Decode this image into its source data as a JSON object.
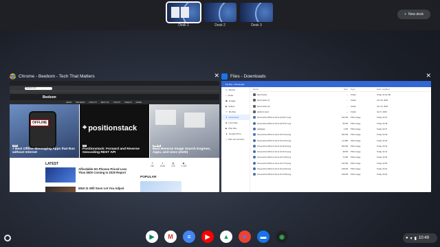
{
  "desks": [
    {
      "label": "Desk 1",
      "active": true
    },
    {
      "label": "Desk 2",
      "active": false
    },
    {
      "label": "Desk 3",
      "active": false
    }
  ],
  "new_desk_label": "New desk",
  "windows": {
    "chrome": {
      "title": "Chrome - Beebom - Tech That Matters",
      "url": "beebom.com",
      "site": {
        "brand": "Beebom",
        "nav": [
          "NEWS",
          "REVIEWS",
          "HOW TO",
          "BEST OF",
          "TOPICS",
          "VIDEOS",
          "MORE"
        ],
        "heroes": [
          {
            "caption": "7 Best Offline Messaging Apps that Run without Internet",
            "badge": "OFFLINE"
          },
          {
            "caption": "Positionstack: Forward and Reverse Geocoding REST API",
            "logo": "positionstack"
          },
          {
            "caption": "Best Reverse Image Search Engines, Apps, and Uses (2020)"
          }
        ],
        "latest_heading": "LATEST",
        "latest": [
          "Affordable 5G Phones Priced Less Than $500 Coming In 2020 Report",
          "MIUI 11 Will Soon Let You Adjust"
        ],
        "social": [
          {
            "icon": "f",
            "count": "1M"
          },
          {
            "icon": "t",
            "count": "413k"
          },
          {
            "icon": "◎",
            "count": "17k"
          },
          {
            "icon": "▶",
            "count": "1.1M"
          }
        ],
        "popular_heading": "POPULAR"
      }
    },
    "files": {
      "title": "Files - Downloads",
      "path": "My files  ›  Downloads",
      "sidebar": [
        "Recent",
        "Audio",
        "Images",
        "Videos",
        "My files",
        "Downloads",
        "Linux files",
        "Play files",
        "Google Drive",
        "Add new services"
      ],
      "columns": [
        "Name",
        "Size",
        "Type",
        "Date modified"
      ],
      "rows": [
        {
          "name": "New Folder",
          "size": "--",
          "type": "Folder",
          "date": "Today 10:41 AM"
        },
        {
          "name": "New Folder (1)",
          "size": "--",
          "type": "Folder",
          "date": "Jan 20, 2020"
        },
        {
          "name": "New Folder (2)",
          "size": "--",
          "type": "Folder",
          "date": "Jan 14, 2020"
        },
        {
          "name": "platform-tools",
          "size": "--",
          "type": "Folder",
          "date": "Jan 5, 2020"
        },
        {
          "name": "Screenshot 2019-11-19 at 10.48.17.png",
          "size": "104 KB",
          "type": "PNG image",
          "date": "Today 10:47"
        },
        {
          "name": "Screenshot 2019-11-19 at 10.45.37.png",
          "size": "99 KB",
          "type": "PNG image",
          "date": "Today 10:46"
        },
        {
          "name": "wallpaper",
          "size": "2 KB",
          "type": "PNG image",
          "date": "Today 10:47"
        },
        {
          "name": "Screenshot 2019-11-19 at 10.31.10.png",
          "size": "462 KB",
          "type": "PNG image",
          "date": "Today 10:46"
        },
        {
          "name": "Screenshot 2019-11-19 at 10.44.23.png",
          "size": "1.6 MB",
          "type": "PNG image",
          "date": "Today 10:44"
        },
        {
          "name": "Screenshot 2019-11-19 at 10.40.33.png",
          "size": "460 KB",
          "type": "PNG image",
          "date": "Today 10:44"
        },
        {
          "name": "Screenshot 2019-11-19 at 10.36.13.png",
          "size": "48 KB",
          "type": "PNG image",
          "date": "Today 10:41"
        },
        {
          "name": "Screenshot 2019-11-19 at 10.31.35.png",
          "size": "72 KB",
          "type": "PNG image",
          "date": "Today 10:32"
        },
        {
          "name": "Screenshot 2019-11-19 at 10.27.24.png",
          "size": "132 KB",
          "type": "PNG image",
          "date": "Today 10:29"
        },
        {
          "name": "Screenshot 2019-11-19 at 10.24.46.png",
          "size": "148 KB",
          "type": "PNG image",
          "date": "Today 10:24"
        },
        {
          "name": "Screenshot 2019-11-19 at 10.19.55.png",
          "size": "108 KB",
          "type": "PNG image",
          "date": "Today 10:20"
        }
      ]
    }
  },
  "shelf": {
    "apps": [
      {
        "name": "play-store",
        "glyph": "▶",
        "bg": "#ffffff",
        "fg": "#01875f"
      },
      {
        "name": "gmail",
        "glyph": "M",
        "bg": "#ffffff",
        "fg": "#d93025"
      },
      {
        "name": "docs",
        "glyph": "≡",
        "bg": "#4285f4",
        "fg": "#ffffff"
      },
      {
        "name": "youtube",
        "glyph": "▶",
        "bg": "#ff0000",
        "fg": "#ffffff"
      },
      {
        "name": "drive",
        "glyph": "▲",
        "bg": "#ffffff",
        "fg": "#0f9d58"
      },
      {
        "name": "chrome",
        "glyph": "●",
        "bg": "#ea4335",
        "fg": "#4285f4"
      },
      {
        "name": "files",
        "glyph": "▬",
        "bg": "#1a73e8",
        "fg": "#ffffff"
      },
      {
        "name": "camera",
        "glyph": "◉",
        "bg": "#202124",
        "fg": "#34a853"
      }
    ],
    "time": "10:49"
  }
}
